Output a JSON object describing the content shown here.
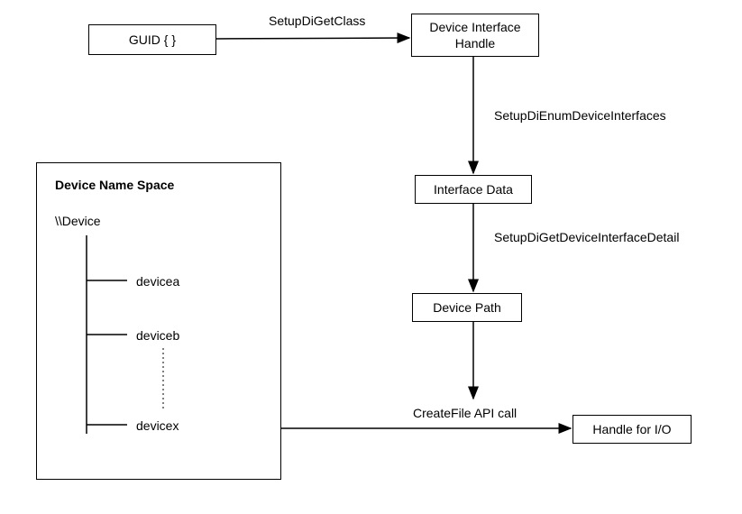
{
  "nodes": {
    "guid": "GUID { }",
    "device_interface_handle": "Device Interface\nHandle",
    "interface_data": "Interface Data",
    "device_path": "Device Path",
    "handle_io": "Handle for I/O"
  },
  "edges": {
    "setup_di_get_class": "SetupDiGetClass",
    "setup_di_enum": "SetupDiEnumDeviceInterfaces",
    "setup_di_detail": "SetupDiGetDeviceInterfaceDetail",
    "createfile": "CreateFile API call"
  },
  "namespace": {
    "title": "Device Name Space",
    "root": "\\\\Device",
    "items": [
      "devicea",
      "deviceb",
      "devicex"
    ]
  }
}
